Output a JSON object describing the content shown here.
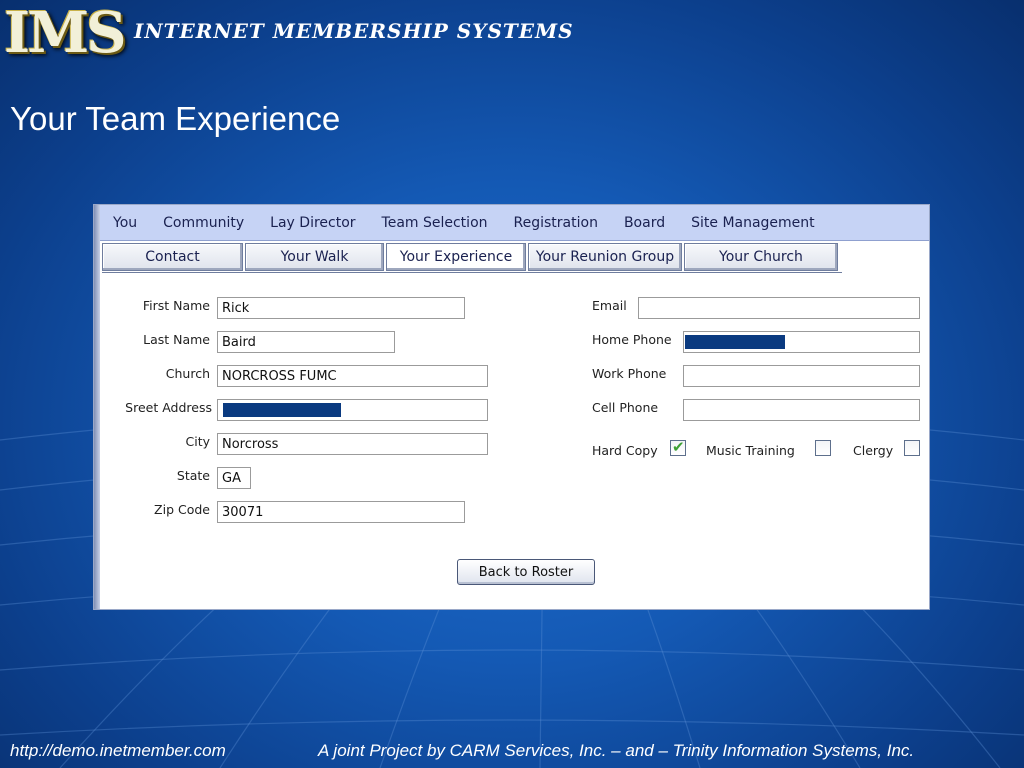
{
  "header": {
    "logo": "IMS",
    "tagline": "Internet Membership Systems"
  },
  "slide_title": "Your Team Experience",
  "app": {
    "menu": [
      "You",
      "Community",
      "Lay Director",
      "Team Selection",
      "Registration",
      "Board",
      "Site Management"
    ],
    "tabs": [
      "Contact",
      "Your Walk",
      "Your Experience",
      "Your Reunion Group",
      "Your Church"
    ],
    "fields": {
      "first_name": {
        "label": "First Name",
        "value": "Rick"
      },
      "last_name": {
        "label": "Last Name",
        "value": "Baird"
      },
      "church": {
        "label": "Church",
        "value": "NORCROSS FUMC"
      },
      "street_address": {
        "label": "Sreet Address",
        "value": ""
      },
      "city": {
        "label": "City",
        "value": "Norcross"
      },
      "state": {
        "label": "State",
        "value": "GA"
      },
      "zip": {
        "label": "Zip Code",
        "value": "30071"
      },
      "email": {
        "label": "Email",
        "value": ""
      },
      "home_phone": {
        "label": "Home Phone",
        "value": ""
      },
      "work_phone": {
        "label": "Work Phone",
        "value": ""
      },
      "cell_phone": {
        "label": "Cell Phone",
        "value": ""
      }
    },
    "checks": {
      "hard_copy": {
        "label": "Hard Copy",
        "checked": true
      },
      "music_training": {
        "label": "Music Training",
        "checked": false
      },
      "clergy": {
        "label": "Clergy",
        "checked": false
      }
    },
    "back_button": "Back to Roster",
    "redaction_color": "#0a3a80"
  },
  "footer": {
    "url": "http://demo.inetmember.com",
    "credit": "A joint Project by CARM Services, Inc. – and – Trinity Information Systems, Inc."
  },
  "icons": {
    "checkmark": "check-icon"
  }
}
